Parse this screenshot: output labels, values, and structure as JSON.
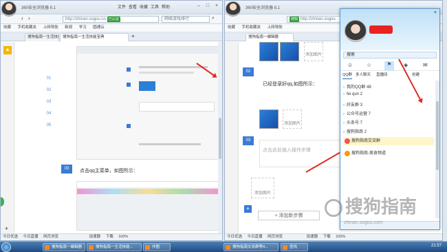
{
  "left": {
    "title": "360安全浏览器 8.1",
    "menus": [
      "文件",
      "查看",
      "收藏",
      "工具",
      "帮助"
    ],
    "url": "http://zhinan.sogou.co",
    "verified": "已认证",
    "search_placeholder": "网络游戏排行",
    "bookmarks": [
      "收藏",
      "手机收藏夹",
      "上网导航",
      "新闻",
      "学习",
      "圆通云"
    ],
    "tabs": [
      "搜狗指南一生活技能宝典",
      "搜狗指南一生活技能宝典"
    ],
    "side_numbers": [
      "01",
      "02",
      "03",
      "04",
      "05"
    ],
    "step3": "03",
    "step3_text": "点击qq主菜单，如图所示：",
    "status": [
      "今日优选",
      "今日直播",
      "网页浏览",
      "加速器",
      "下载",
      "100%"
    ]
  },
  "right": {
    "title": "360安全浏览器 8.1",
    "url": "http://zhinan.sogou",
    "verified": "搜狗",
    "bookmarks": [
      "收藏",
      "手机收藏夹",
      "上网导航"
    ],
    "tabs": [
      "搜狗指南一编辑器"
    ],
    "step2": "02",
    "step2_text": "已经登录好qq,如图所示：",
    "step3": "03",
    "step3_placeholder": "点击此处输入操作步骤",
    "add_image": "添加图片",
    "add_step": "+ 添加新步骤",
    "status": [
      "今日优选",
      "今日直播",
      "网页浏览",
      "加速器",
      "下载",
      "100%"
    ]
  },
  "qq": {
    "search": "搜索",
    "tabs": [
      "QQ群",
      "多人聊天",
      "直播间"
    ],
    "create": "创建",
    "groups": [
      "我的QQ群 48",
      "fei qun 2",
      "好友群 3",
      "公众号运营 7",
      "头条号 7",
      "搜狗指南 2"
    ],
    "chats": [
      "搜狗指南交流群",
      "搜狗指南-美食频道"
    ]
  },
  "watermark": "搜狗指南",
  "watermark_url": "zhinan.sogou.com",
  "taskbar": {
    "tasks": [
      "搜狗指南一编辑器",
      "搜狗指南一生活技能...",
      "作图",
      "搜狗指南交流群等4...",
      "查找"
    ],
    "time": "21:57"
  }
}
